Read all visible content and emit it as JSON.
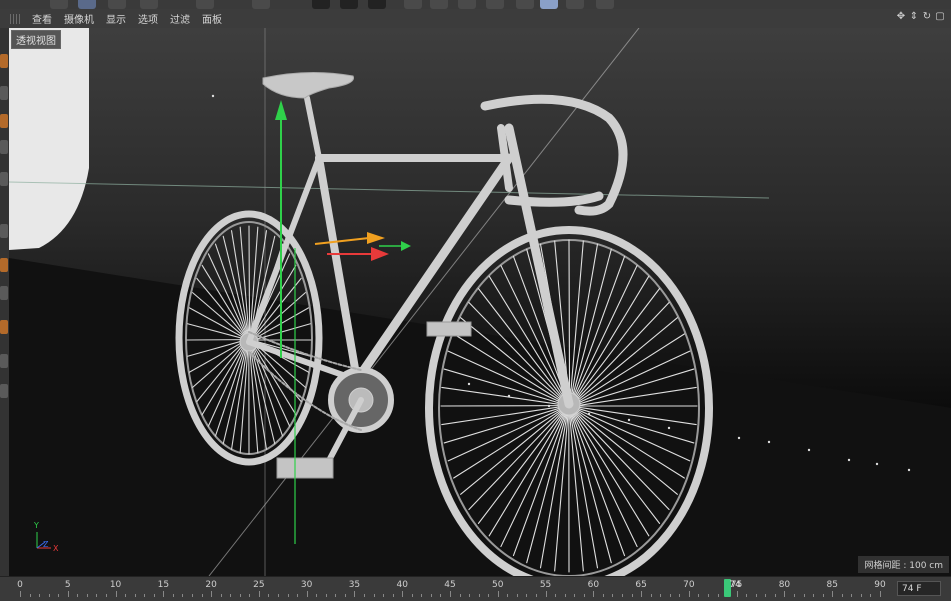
{
  "menu": {
    "items": [
      "查看",
      "摄像机",
      "显示",
      "选项",
      "过滤",
      "面板"
    ]
  },
  "viewport": {
    "label": "透视视图",
    "grid_spacing": "网格间距 : 100 cm",
    "axis_y": "Y",
    "axis_z": "Z",
    "axis_x": "X"
  },
  "timeline": {
    "ticks": [
      "0",
      "5",
      "10",
      "15",
      "20",
      "25",
      "30",
      "35",
      "40",
      "45",
      "50",
      "55",
      "60",
      "65",
      "70",
      "75",
      "80",
      "85",
      "90"
    ],
    "current_frame_label": "74",
    "frame_field": "74 F",
    "current_frame": 74
  },
  "colors": {
    "axis_y_green": "#2fd14a",
    "axis_x_red": "#e83a3a",
    "axis_z_orange": "#f0a020",
    "playhead": "#3ac878"
  },
  "icons": {
    "navigation": [
      "move-view-icon",
      "zoom-view-icon",
      "rotate-view-icon",
      "toggle-view-icon"
    ]
  }
}
